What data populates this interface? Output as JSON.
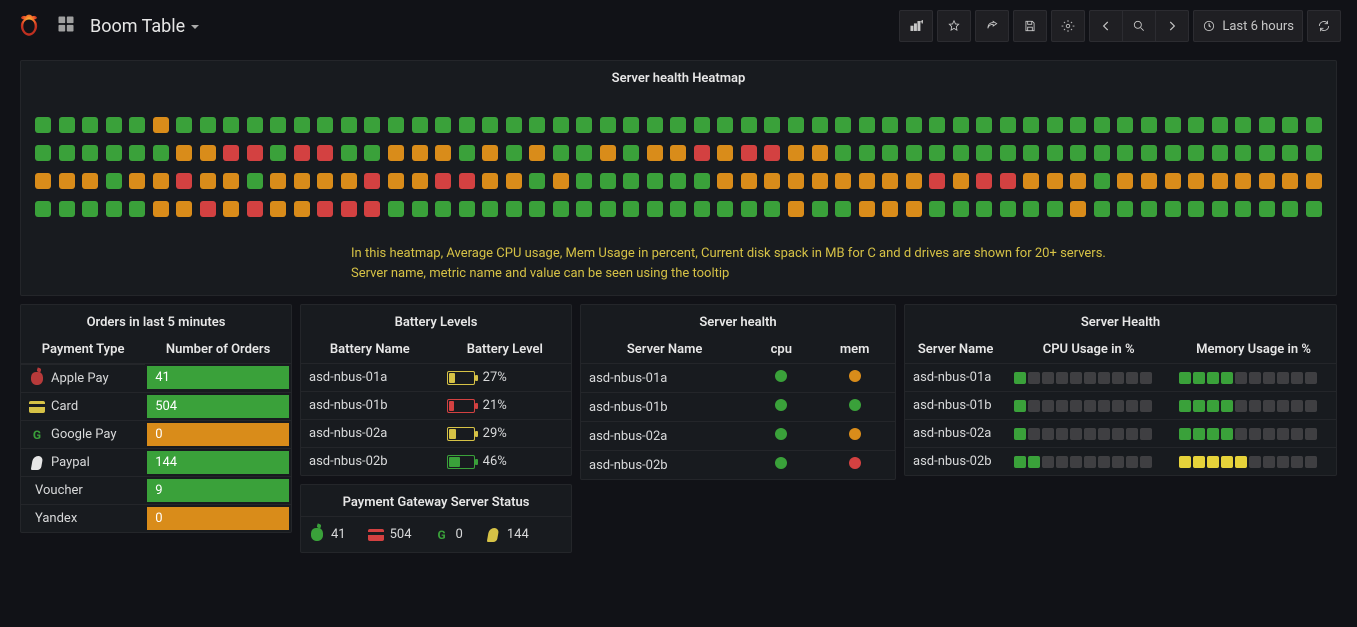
{
  "header": {
    "title": "Boom Table",
    "time_range_label": "Last 6 hours"
  },
  "heatmap": {
    "title": "Server health Heatmap",
    "caption_line1": "In this heatmap, Average CPU usage, Mem Usage in percent, Current disk spack in MB for C and d drives are shown for 20+ servers.",
    "caption_line2": "Server name, metric name and value can be seen using the tooltip",
    "rows": [
      [
        "g",
        "g",
        "g",
        "g",
        "g",
        "o",
        "g",
        "g",
        "g",
        "g",
        "g",
        "g",
        "g",
        "g",
        "g",
        "g",
        "g",
        "g",
        "g",
        "g",
        "g",
        "g",
        "g",
        "g",
        "g",
        "g",
        "g",
        "g",
        "g",
        "g",
        "g",
        "g",
        "g",
        "g",
        "g",
        "g",
        "g",
        "g",
        "g",
        "g",
        "g",
        "g",
        "g",
        "g",
        "g",
        "g",
        "g",
        "g",
        "g",
        "g",
        "g",
        "g",
        "g",
        "g",
        "g"
      ],
      [
        "g",
        "g",
        "g",
        "g",
        "g",
        "g",
        "o",
        "o",
        "r",
        "r",
        "g",
        "r",
        "r",
        "g",
        "g",
        "o",
        "o",
        "o",
        "g",
        "o",
        "g",
        "o",
        "g",
        "g",
        "o",
        "g",
        "o",
        "o",
        "r",
        "o",
        "r",
        "r",
        "o",
        "o",
        "g",
        "g",
        "g",
        "g",
        "g",
        "g",
        "g",
        "g",
        "g",
        "g",
        "g",
        "g",
        "g",
        "g",
        "g",
        "g",
        "g",
        "g",
        "g",
        "g",
        "g"
      ],
      [
        "o",
        "o",
        "o",
        "g",
        "o",
        "o",
        "r",
        "o",
        "o",
        "g",
        "o",
        "o",
        "o",
        "o",
        "r",
        "o",
        "o",
        "r",
        "r",
        "o",
        "o",
        "g",
        "o",
        "g",
        "g",
        "g",
        "g",
        "g",
        "g",
        "o",
        "o",
        "o",
        "o",
        "o",
        "o",
        "o",
        "o",
        "o",
        "r",
        "o",
        "r",
        "r",
        "o",
        "o",
        "o",
        "g",
        "o",
        "o",
        "o",
        "o",
        "o",
        "o",
        "o",
        "o",
        "o"
      ],
      [
        "g",
        "g",
        "g",
        "g",
        "g",
        "o",
        "o",
        "r",
        "o",
        "r",
        "o",
        "o",
        "r",
        "r",
        "r",
        "g",
        "g",
        "g",
        "g",
        "g",
        "g",
        "g",
        "g",
        "g",
        "g",
        "g",
        "g",
        "g",
        "g",
        "g",
        "g",
        "g",
        "o",
        "g",
        "g",
        "o",
        "o",
        "o",
        "g",
        "g",
        "g",
        "g",
        "g",
        "g",
        "o",
        "g",
        "g",
        "g",
        "g",
        "g",
        "g",
        "g",
        "g",
        "g",
        "g"
      ]
    ]
  },
  "orders_panel": {
    "title": "Orders in last 5 minutes",
    "columns": [
      "Payment Type",
      "Number of Orders"
    ],
    "rows": [
      {
        "icon": "apple",
        "icon_color": "i-apple",
        "name": "Apple Pay",
        "value": "41",
        "bar": "green"
      },
      {
        "icon": "card",
        "icon_color": "i-card",
        "name": "Card",
        "value": "504",
        "bar": "green"
      },
      {
        "icon": "google",
        "icon_color": "i-google",
        "name": "Google Pay",
        "value": "0",
        "bar": "orange"
      },
      {
        "icon": "paypal",
        "icon_color": "i-paypal",
        "name": "Paypal",
        "value": "144",
        "bar": "green"
      },
      {
        "icon": "none",
        "icon_color": "",
        "name": "Voucher",
        "value": "9",
        "bar": "green"
      },
      {
        "icon": "none",
        "icon_color": "",
        "name": "Yandex",
        "value": "0",
        "bar": "orange"
      }
    ]
  },
  "battery_panel": {
    "title": "Battery Levels",
    "columns": [
      "Battery Name",
      "Battery Level"
    ],
    "rows": [
      {
        "name": "asd-nbus-01a",
        "pct": 27,
        "label": "27%",
        "color": "orange"
      },
      {
        "name": "asd-nbus-01b",
        "pct": 21,
        "label": "21%",
        "color": "red"
      },
      {
        "name": "asd-nbus-02a",
        "pct": 29,
        "label": "29%",
        "color": "orange"
      },
      {
        "name": "asd-nbus-02b",
        "pct": 46,
        "label": "46%",
        "color": "green"
      }
    ]
  },
  "server_health_panel": {
    "title": "Server health",
    "columns": [
      "Server Name",
      "cpu",
      "mem"
    ],
    "rows": [
      {
        "name": "asd-nbus-01a",
        "cpu": "g",
        "mem": "o"
      },
      {
        "name": "asd-nbus-01b",
        "cpu": "g",
        "mem": "g"
      },
      {
        "name": "asd-nbus-02a",
        "cpu": "g",
        "mem": "o"
      },
      {
        "name": "asd-nbus-02b",
        "cpu": "g",
        "mem": "r"
      }
    ]
  },
  "server_health_bars_panel": {
    "title": "Server Health",
    "columns": [
      "Server Name",
      "CPU Usage in %",
      "Memory Usage in %"
    ],
    "rows": [
      {
        "name": "asd-nbus-01a",
        "cpu_fill": 1,
        "cpu_color": "g",
        "mem_fill": 4,
        "mem_color": "g"
      },
      {
        "name": "asd-nbus-01b",
        "cpu_fill": 1,
        "cpu_color": "g",
        "mem_fill": 4,
        "mem_color": "g"
      },
      {
        "name": "asd-nbus-02a",
        "cpu_fill": 1,
        "cpu_color": "g",
        "mem_fill": 4,
        "mem_color": "g"
      },
      {
        "name": "asd-nbus-02b",
        "cpu_fill": 2,
        "cpu_color": "g",
        "mem_fill": 5,
        "mem_color": "y"
      }
    ]
  },
  "payment_gateway_panel": {
    "title": "Payment Gateway Server Status",
    "items": [
      {
        "icon": "apple",
        "icon_color": "i-apple-green",
        "value": "41"
      },
      {
        "icon": "card",
        "icon_color": "i-card-red",
        "value": "504"
      },
      {
        "icon": "google",
        "icon_color": "i-google",
        "value": "0"
      },
      {
        "icon": "paypal",
        "icon_color": "i-card",
        "value": "144"
      }
    ]
  },
  "chart_data": {
    "type": "heatmap",
    "title": "Server health Heatmap",
    "legend": {
      "g": "green/ok",
      "o": "orange/warn",
      "r": "red/critical"
    },
    "grid_rows": 4,
    "grid_cols": 55
  }
}
